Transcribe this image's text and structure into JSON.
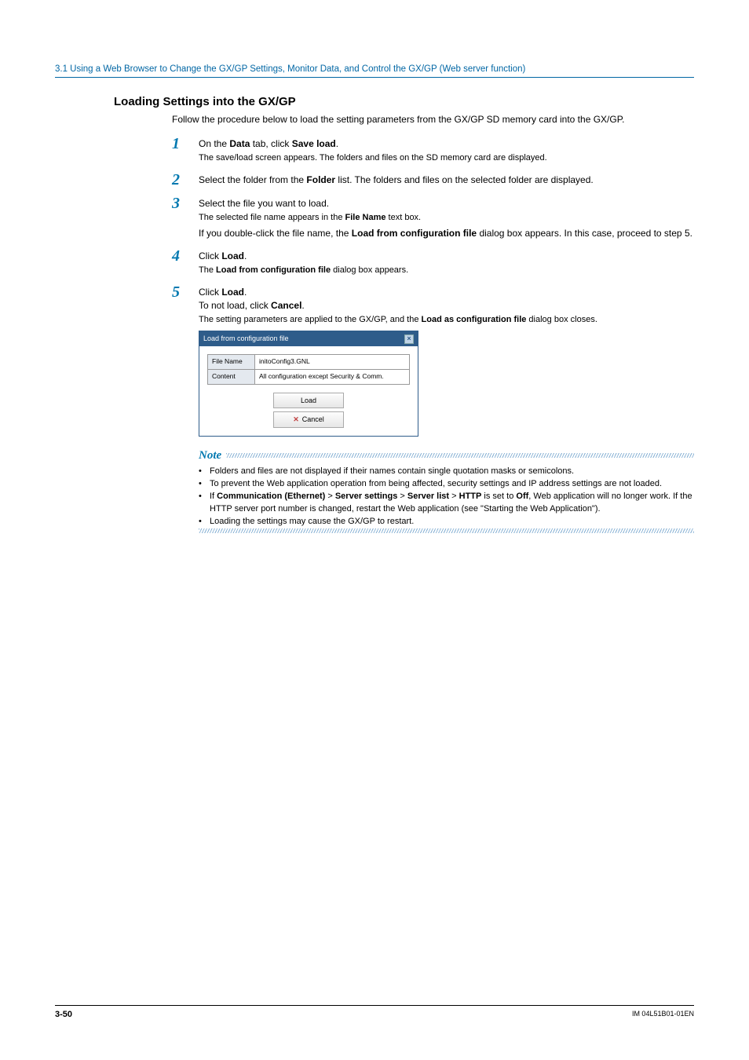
{
  "header": {
    "breadcrumb": "3.1  Using a Web Browser to Change the GX/GP Settings, Monitor Data, and Control the GX/GP (Web server function)"
  },
  "section": {
    "title": "Loading Settings into the GX/GP",
    "intro": "Follow the procedure below to load the setting parameters from the GX/GP SD memory card into the GX/GP."
  },
  "steps": {
    "s1": {
      "num": "1",
      "pre": "On the ",
      "b1": "Data",
      "mid": " tab, click ",
      "b2": "Save load",
      "post": ".",
      "sub": "The save/load screen appears. The folders and files on the SD memory card are displayed."
    },
    "s2": {
      "num": "2",
      "pre": "Select the folder from the ",
      "b1": "Folder",
      "post": " list. The folders and files on the selected folder are displayed."
    },
    "s3": {
      "num": "3",
      "main": "Select the file you want to load.",
      "sub_pre": "The selected file name appears in the ",
      "sub_b": "File Name",
      "sub_post": " text box.",
      "extra_pre": "If you double-click the file name, the ",
      "extra_b": "Load from configuration file",
      "extra_post": " dialog box appears. In this case, proceed to step 5."
    },
    "s4": {
      "num": "4",
      "pre": "Click ",
      "b1": "Load",
      "post": ".",
      "sub_pre": "The ",
      "sub_b": "Load from configuration file",
      "sub_post": " dialog box appears."
    },
    "s5": {
      "num": "5",
      "pre": "Click ",
      "b1": "Load",
      "post": ".",
      "l2_pre": "To not load, click ",
      "l2_b": "Cancel",
      "l2_post": ".",
      "sub_pre": "The setting parameters are applied to the GX/GP, and the ",
      "sub_b": "Load as configuration file",
      "sub_post": " dialog box closes."
    }
  },
  "dialog": {
    "title": "Load from configuration file",
    "row1_label": "File Name",
    "row1_value": "initoConfig3.GNL",
    "row2_label": "Content",
    "row2_value": "All configuration except Security & Comm.",
    "btn_load": "Load",
    "btn_cancel": "Cancel"
  },
  "note": {
    "label": "Note",
    "b1": "Folders and files are not displayed if their names contain single quotation masks or semicolons.",
    "b2": "To prevent the Web application operation from being affected, security settings and IP address settings are not loaded.",
    "b3_pre": "If ",
    "b3_1": "Communication (Ethernet)",
    "b3_s1": " > ",
    "b3_2": "Server settings",
    "b3_s2": " > ",
    "b3_3": "Server list",
    "b3_s3": " > ",
    "b3_4": "HTTP",
    "b3_mid": " is set to ",
    "b3_5": "Off",
    "b3_post": ", Web application will no longer work. If the HTTP server port number is changed, restart the Web application (see \"Starting the Web Application\").",
    "b4": "Loading the settings may cause the GX/GP to restart."
  },
  "footer": {
    "page": "3-50",
    "doc": "IM 04L51B01-01EN"
  }
}
